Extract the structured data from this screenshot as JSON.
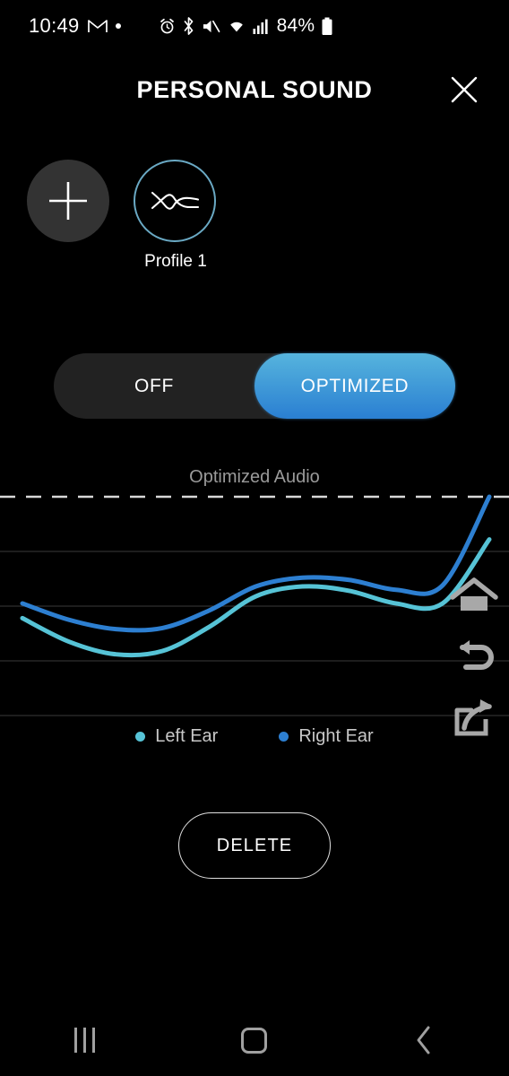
{
  "status_bar": {
    "time": "10:49",
    "battery_percent": "84%",
    "icons": [
      "gmail-icon",
      "dot-icon",
      "alarm-icon",
      "bluetooth-icon",
      "mute-icon",
      "wifi-icon",
      "signal-icon",
      "battery-icon"
    ]
  },
  "header": {
    "title": "PERSONAL SOUND",
    "close_icon": "close-icon"
  },
  "profiles": {
    "add_icon": "plus-icon",
    "items": [
      {
        "label": "Profile 1",
        "icon": "sound-wave-icon",
        "selected": true
      }
    ]
  },
  "toggle": {
    "off_label": "OFF",
    "on_label": "OPTIMIZED",
    "selected": "OPTIMIZED",
    "accent_top": "#56b4dd",
    "accent_bottom": "#2a7fd2"
  },
  "chart_caption": "Optimized Audio",
  "legend": [
    {
      "label": "Left Ear",
      "color": "#56c3d6"
    },
    {
      "label": "Right Ear",
      "color": "#2d7fd1"
    }
  ],
  "actions": {
    "delete_label": "DELETE"
  },
  "overlay_icons": [
    "home-icon",
    "back-icon",
    "share-icon"
  ],
  "nav_bar": {
    "recents_icon": "recents-icon",
    "home_icon": "home-icon",
    "back_icon": "back-icon"
  },
  "chart_data": {
    "type": "line",
    "title": "Optimized Audio",
    "xlabel": "",
    "ylabel": "",
    "grid": true,
    "gridlines_y": [
      0.0,
      1.0,
      2.0,
      3.0,
      4.0
    ],
    "reference_line": {
      "label": "Optimized Audio",
      "y": 4.0,
      "style": "dashed",
      "color": "#d8d8d8"
    },
    "legend_position": "bottom",
    "xlim": [
      0,
      10
    ],
    "ylim": [
      0,
      4
    ],
    "x": [
      0,
      1,
      2,
      3,
      4,
      5,
      6,
      7,
      8,
      9,
      10
    ],
    "series": [
      {
        "name": "Left Ear",
        "color": "#56c3d6",
        "values": [
          1.78,
          1.35,
          1.12,
          1.18,
          1.62,
          2.18,
          2.36,
          2.28,
          2.05,
          2.05,
          3.22
        ]
      },
      {
        "name": "Right Ear",
        "color": "#2d7fd1",
        "values": [
          2.05,
          1.75,
          1.58,
          1.6,
          1.92,
          2.36,
          2.52,
          2.48,
          2.3,
          2.38,
          4.0
        ]
      }
    ]
  }
}
